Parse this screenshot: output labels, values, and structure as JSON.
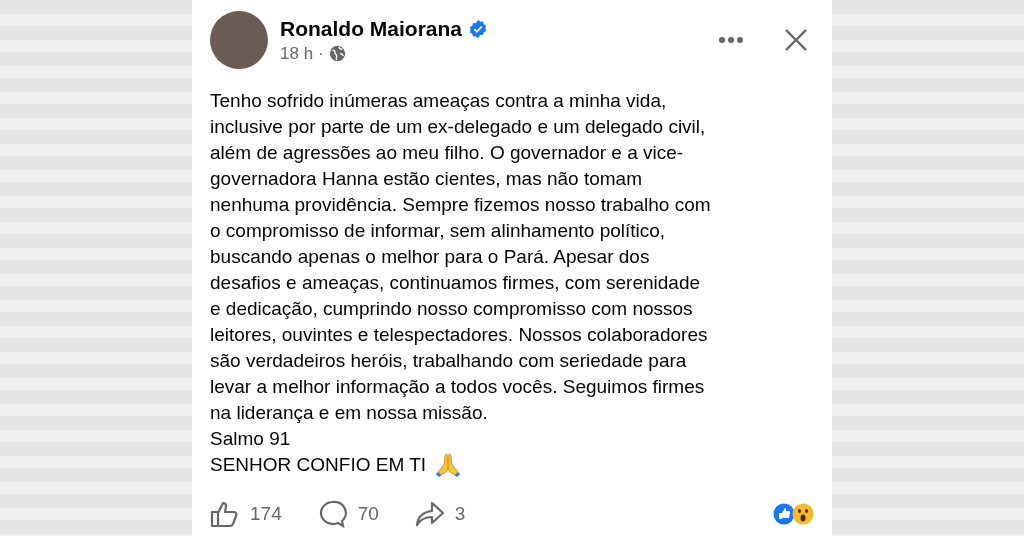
{
  "post": {
    "author": "Ronaldo Maiorana",
    "verified": true,
    "time": "18 h",
    "separator": "·",
    "lines": [
      "Tenho sofrido inúmeras ameaças contra a minha vida,",
      "inclusive por parte de um ex-delegado e um delegado civil,",
      "além de agressões ao meu filho. O governador e a vice-",
      "governadora Hanna estão cientes, mas não tomam",
      "nenhuma providência. Sempre fizemos nosso trabalho com",
      "o compromisso de informar, sem alinhamento político,",
      "buscando apenas o melhor para o Pará. Apesar dos",
      "desafios e ameaças, continuamos firmes, com serenidade",
      "e dedicação, cumprindo nosso compromisso com nossos",
      "leitores, ouvintes e telespectadores. Nossos colaboradores",
      "são verdadeiros heróis, trabalhando com seriedade para",
      "levar a melhor informação a todos vocês. Seguimos firmes",
      "na liderança e em nossa missão."
    ],
    "psalm": "Salmo 91",
    "closing": "SENHOR CONFIO EM TI"
  },
  "footer": {
    "likes": "174",
    "comments": "70",
    "shares": "3"
  }
}
